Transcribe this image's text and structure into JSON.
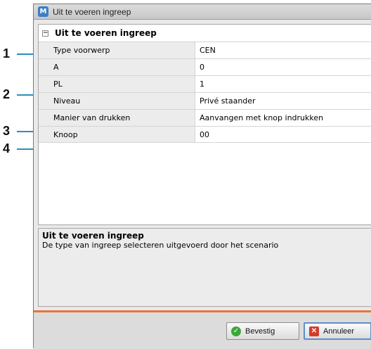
{
  "window": {
    "title": "Uit te voeren ingreep",
    "app_icon_glyph": "M"
  },
  "section": {
    "title": "Uit te voeren ingreep",
    "collapse_glyph": "−"
  },
  "properties": [
    {
      "name": "Type voorwerp",
      "value": "CEN"
    },
    {
      "name": "A",
      "value": "0"
    },
    {
      "name": "PL",
      "value": "1"
    },
    {
      "name": "Niveau",
      "value": "Privé staander"
    },
    {
      "name": "Manier van drukken",
      "value": "Aanvangen met knop indrukken"
    },
    {
      "name": "Knoop",
      "value": "00"
    }
  ],
  "description": {
    "title": "Uit te voeren ingreep",
    "text": "De type van ingreep selecteren uitgevoerd door het scenario"
  },
  "buttons": {
    "confirm_label": "Bevestig",
    "cancel_label": "Annuleer",
    "confirm_icon": "check-circle-icon",
    "cancel_icon": "close-box-icon"
  },
  "callouts": [
    "1",
    "2",
    "3",
    "4"
  ],
  "colors": {
    "accent": "#e8743b",
    "callout_line": "#2a8fbd",
    "app_icon": "#3a7fc4"
  }
}
